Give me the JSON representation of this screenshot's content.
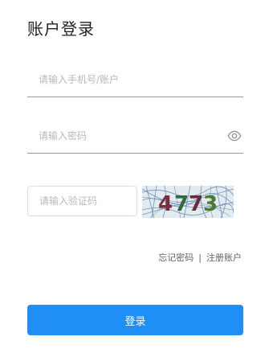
{
  "title": "账户登录",
  "account": {
    "placeholder": "请输入手机号/账户",
    "value": ""
  },
  "password": {
    "placeholder": "请输入密码",
    "value": ""
  },
  "captcha": {
    "placeholder": "请输入验证码",
    "value": "",
    "image_text": "4773"
  },
  "links": {
    "forgot": "忘记密码",
    "separator": "|",
    "register": "注册账户"
  },
  "login_button": "登录",
  "colors": {
    "primary": "#1f8ef5",
    "underline": "#9a9a9a",
    "placeholder": "#b5b8bf"
  },
  "icons": {
    "password_toggle": "eye-icon"
  }
}
